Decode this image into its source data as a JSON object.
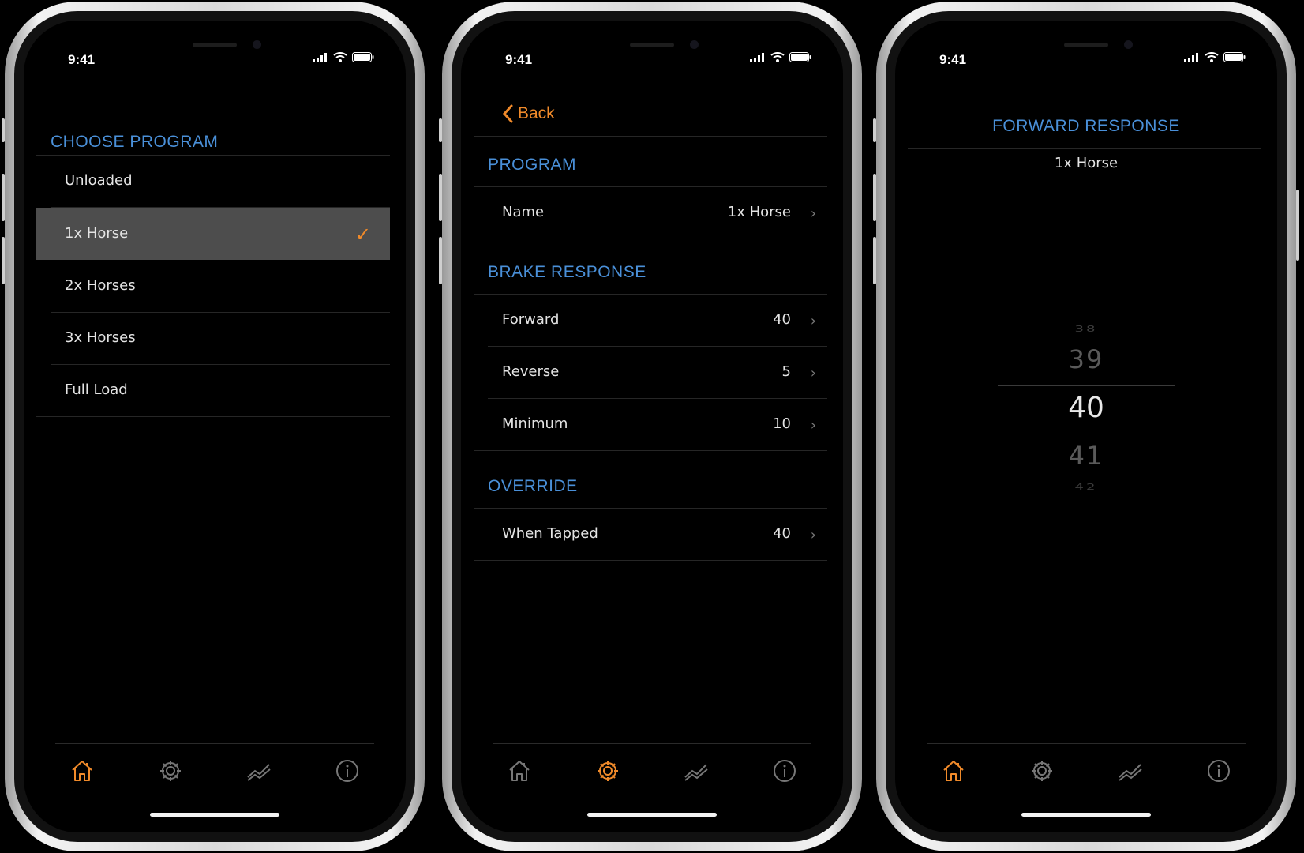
{
  "status": {
    "time": "9:41"
  },
  "screen1": {
    "header": "CHOOSE PROGRAM",
    "items": [
      {
        "label": "Unloaded"
      },
      {
        "label": "1x Horse",
        "selected": true
      },
      {
        "label": "2x Horses"
      },
      {
        "label": "3x Horses"
      },
      {
        "label": "Full Load"
      }
    ],
    "check_icon": "checkmark-icon"
  },
  "screen2": {
    "back_label": "Back",
    "program_header": "PROGRAM",
    "name_label": "Name",
    "name_value": "1x Horse",
    "brake_header": "BRAKE RESPONSE",
    "brake_rows": [
      {
        "label": "Forward",
        "value": "40"
      },
      {
        "label": "Reverse",
        "value": "5"
      },
      {
        "label": "Minimum",
        "value": "10"
      }
    ],
    "override_header": "OVERRIDE",
    "override_label": "When Tapped",
    "override_value": "40"
  },
  "screen3": {
    "title": "FORWARD RESPONSE",
    "subtitle": "1x Horse",
    "picker": [
      "38",
      "39",
      "40",
      "41",
      "42"
    ],
    "selected_value": "40"
  },
  "tabbar": {
    "tabs": [
      "home-icon",
      "gear-icon",
      "chart-icon",
      "info-icon"
    ],
    "screen1_active": "home-icon",
    "screen2_active": "gear-icon",
    "screen3_active": "home-icon"
  },
  "colors": {
    "accent": "#f08a2a",
    "header_blue": "#4a90d9",
    "selected_row": "#4d4d4d",
    "background": "#000000"
  }
}
